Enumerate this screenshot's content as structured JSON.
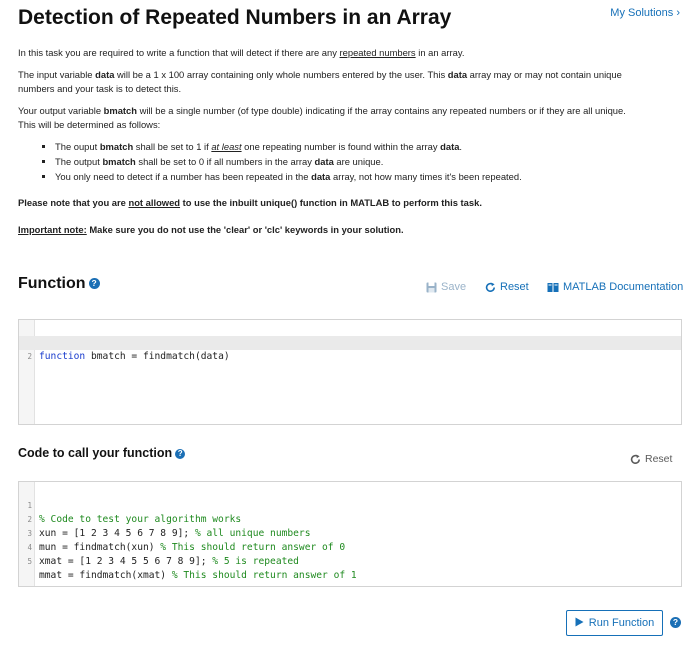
{
  "header": {
    "title": "Detection of Repeated Numbers in an Array",
    "my_solutions": "My Solutions ›"
  },
  "description": {
    "p1_before": "In this task you are required to write a function that will detect if there are any ",
    "p1_link": "repeated numbers",
    "p1_after": " in an array.",
    "p2_a": "The input variable ",
    "p2_b": "data",
    "p2_c": " will be a 1 x 100 array containing only whole numbers entered by the user. This ",
    "p2_d": "data",
    "p2_e": " array may or may not contain unique numbers and your task is to detect this.",
    "p3_a": "Your output variable ",
    "p3_b": "bmatch",
    "p3_c": " will be a single number (of type double) indicating if the array contains any repeated numbers or if they are all unique. This will be determined as follows:",
    "b1_a": "The ouput ",
    "b1_b": "bmatch",
    "b1_c": " shall be set to 1 if ",
    "b1_d": "at least",
    "b1_e": " one repeating number is found within the array ",
    "b1_f": "data",
    "b1_g": ".",
    "b2_a": "The output ",
    "b2_b": "bmatch",
    "b2_c": " shall be set to 0 if all numbers in the array ",
    "b2_d": "data",
    "b2_e": " are unique.",
    "b3_a": "You only need to detect if a number has been repeated in the ",
    "b3_b": "data",
    "b3_c": " array, not how many times it's been repeated.",
    "note_a": "Please note that you are ",
    "note_b": "not allowed",
    "note_c": " to use the inbuilt unique() function in MATLAB to perform this task.",
    "note2_a": "Important note:",
    "note2_b": " Make sure you do not use the 'clear' or 'clc' keywords in your solution."
  },
  "function_section": {
    "title": "Function",
    "help_icon": "?",
    "save_label": "Save",
    "reset_label": "Reset",
    "doc_label": "MATLAB Documentation",
    "lines": [
      {
        "num": "1",
        "kw": "function",
        "text": " bmatch = findmatch(data)"
      },
      {
        "num": "2",
        "kw": "",
        "text": ""
      }
    ]
  },
  "call_section": {
    "title": "Code to call your function",
    "help_icon": "?",
    "reset_label": "Reset",
    "lines": [
      {
        "num": "1",
        "code": "",
        "comment": "% Code to test your algorithm works"
      },
      {
        "num": "2",
        "code": "xun = [1 2 3 4 5 6 7 8 9]; ",
        "comment": "% all unique numbers"
      },
      {
        "num": "3",
        "code": "mun = findmatch(xun) ",
        "comment": "% This should return answer of 0"
      },
      {
        "num": "4",
        "code": "xmat = [1 2 3 4 5 5 6 7 8 9]; ",
        "comment": "% 5 is repeated"
      },
      {
        "num": "5",
        "code": "mmat = findmatch(xmat) ",
        "comment": "% This should return answer of 1"
      }
    ]
  },
  "run": {
    "label": "Run Function",
    "help_icon": "?"
  },
  "colors": {
    "accent": "#1670b8",
    "comment": "#1f8a1f",
    "keyword": "#1a3ccd"
  }
}
